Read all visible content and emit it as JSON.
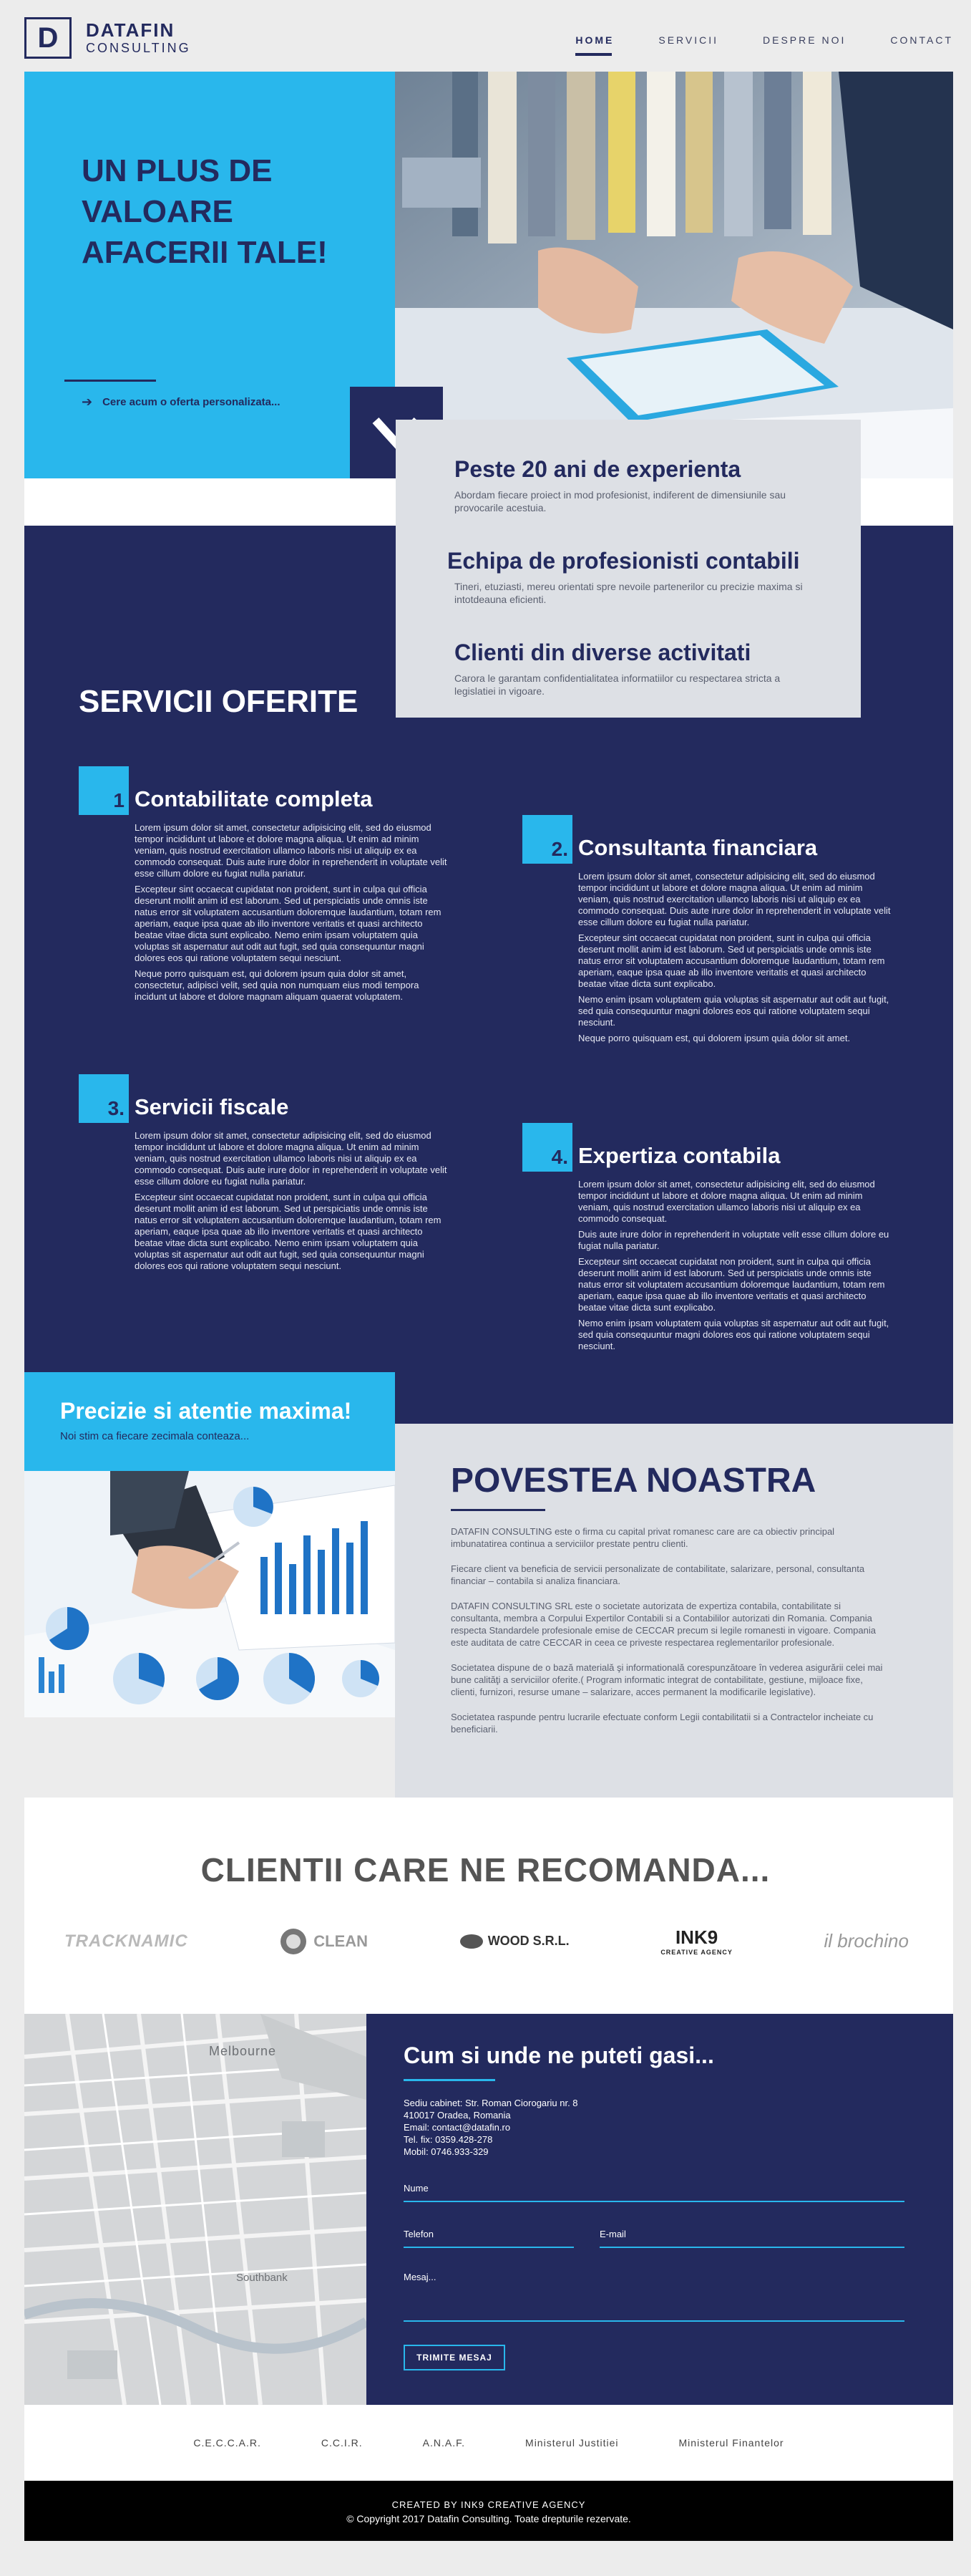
{
  "brand": {
    "letter": "D",
    "name": "DATAFIN",
    "sub": "CONSULTING"
  },
  "nav": [
    {
      "label": "HOME",
      "active": true
    },
    {
      "label": "SERVICII"
    },
    {
      "label": "DESPRE NOI"
    },
    {
      "label": "CONTACT"
    }
  ],
  "hero": {
    "title": "UN PLUS DE VALOARE AFACERII TALE!",
    "cta": "Cere acum o oferta personalizata..."
  },
  "features": [
    {
      "title": "Peste 20 ani de experienta",
      "text": "Abordam fiecare proiect in mod profesionist, indiferent de dimensiunile sau provocarile acestuia."
    },
    {
      "title": "Echipa de profesionisti contabili",
      "text": "Tineri, etuziasti, mereu orientati spre nevoile partenerilor cu precizie maxima si intotdeauna eficienti."
    },
    {
      "title": "Clienti din diverse activitati",
      "text": "Carora le garantam confidentialitatea informatiilor cu respectarea stricta a legislatiei in vigoare."
    }
  ],
  "services": {
    "title": "SERVICII OFERITE",
    "items": [
      {
        "num": "1",
        "title": "Contabilitate completa",
        "paragraphs": [
          "Lorem ipsum dolor sit amet, consectetur adipisicing elit, sed do eiusmod tempor incididunt ut labore et dolore magna aliqua. Ut enim ad minim veniam, quis nostrud exercitation ullamco laboris nisi ut aliquip ex ea commodo consequat. Duis aute irure dolor in reprehenderit in voluptate velit esse cillum dolore eu fugiat nulla pariatur.",
          "Excepteur sint occaecat cupidatat non proident, sunt in culpa qui officia deserunt mollit anim id est laborum. Sed ut perspiciatis unde omnis iste natus error sit voluptatem accusantium doloremque laudantium, totam rem aperiam, eaque ipsa quae ab illo inventore veritatis et quasi architecto beatae vitae dicta sunt explicabo. Nemo enim ipsam voluptatem quia voluptas sit aspernatur aut odit aut fugit, sed quia consequuntur magni dolores eos qui ratione voluptatem sequi nesciunt.",
          "Neque porro quisquam est, qui dolorem ipsum quia dolor sit amet, consectetur, adipisci velit, sed quia non numquam eius modi tempora incidunt ut labore et dolore magnam aliquam quaerat voluptatem."
        ]
      },
      {
        "num": "2.",
        "title": "Consultanta financiara",
        "paragraphs": [
          "Lorem ipsum dolor sit amet, consectetur adipisicing elit, sed do eiusmod tempor incididunt ut labore et dolore magna aliqua. Ut enim ad minim veniam, quis nostrud exercitation ullamco laboris nisi ut aliquip ex ea commodo consequat. Duis aute irure dolor in reprehenderit in voluptate velit esse cillum dolore eu fugiat nulla pariatur.",
          "Excepteur sint occaecat cupidatat non proident, sunt in culpa qui officia deserunt mollit anim id est laborum. Sed ut perspiciatis unde omnis iste natus error sit voluptatem accusantium doloremque laudantium, totam rem aperiam, eaque ipsa quae ab illo inventore veritatis et quasi architecto beatae vitae dicta sunt explicabo.",
          "Nemo enim ipsam voluptatem quia voluptas sit aspernatur aut odit aut fugit, sed quia consequuntur magni dolores eos qui ratione voluptatem sequi nesciunt.",
          "Neque porro quisquam est, qui dolorem ipsum quia dolor sit amet."
        ]
      },
      {
        "num": "3.",
        "title": "Servicii fiscale",
        "paragraphs": [
          "Lorem ipsum dolor sit amet, consectetur adipisicing elit, sed do eiusmod tempor incididunt ut labore et dolore magna aliqua. Ut enim ad minim veniam, quis nostrud exercitation ullamco laboris nisi ut aliquip ex ea commodo consequat. Duis aute irure dolor in reprehenderit in voluptate velit esse cillum dolore eu fugiat nulla pariatur.",
          "Excepteur sint occaecat cupidatat non proident, sunt in culpa qui officia deserunt mollit anim id est laborum. Sed ut perspiciatis unde omnis iste natus error sit voluptatem accusantium doloremque laudantium, totam rem aperiam, eaque ipsa quae ab illo inventore veritatis et quasi architecto beatae vitae dicta sunt explicabo. Nemo enim ipsam voluptatem quia voluptas sit aspernatur aut odit aut fugit, sed quia consequuntur magni dolores eos qui ratione voluptatem sequi nesciunt."
        ]
      },
      {
        "num": "4.",
        "title": "Expertiza contabila",
        "paragraphs": [
          "Lorem ipsum dolor sit amet, consectetur adipisicing elit, sed do eiusmod tempor incididunt ut labore et dolore magna aliqua. Ut enim ad minim veniam, quis nostrud exercitation ullamco laboris nisi ut aliquip ex ea commodo consequat.",
          "Duis aute irure dolor in reprehenderit in voluptate velit esse cillum dolore eu fugiat nulla pariatur.",
          "Excepteur sint occaecat cupidatat non proident, sunt in culpa qui officia deserunt mollit anim id est laborum. Sed ut perspiciatis unde omnis iste natus error sit voluptatem accusantium doloremque laudantium, totam rem aperiam, eaque ipsa quae ab illo inventore veritatis et quasi architecto beatae vitae dicta sunt explicabo.",
          "Nemo enim ipsam voluptatem quia voluptas sit aspernatur aut odit aut fugit, sed quia consequuntur magni dolores eos qui ratione voluptatem sequi nesciunt."
        ]
      }
    ]
  },
  "precision": {
    "title": "Precizie si atentie maxima!",
    "sub": "Noi stim ca fiecare zecimala conteaza..."
  },
  "story": {
    "title": "POVESTEA NOASTRA",
    "paragraphs": [
      "DATAFIN CONSULTING este o firma cu capital privat romanesc care are ca obiectiv principal imbunatatirea continua a serviciilor prestate pentru clienti.",
      "Fiecare client va beneficia de servicii personalizate de contabilitate, salarizare, personal, consultanta financiar – contabila si analiza financiara.",
      "DATAFIN CONSULTING SRL este o societate autorizata de expertiza contabila, contabilitate si consultanta, membra a Corpului Expertilor Contabili si a Contabililor autorizati din Romania. Compania respecta Standardele profesionale emise de CECCAR precum si legile romanesti in vigoare. Compania este auditata de catre CECCAR in ceea ce priveste respectarea reglementarilor profesionale.",
      "Societatea dispune de o bază materială şi informatională corespunzătoare în vederea asigurării celei mai bune calităţi a serviciilor oferite.( Program informatic integrat de contabilitate, gestiune, mijloace fixe, clienti, furnizori, resurse umane – salarizare, acces permanent la modificarile legislative).",
      "Societatea raspunde pentru lucrarile efectuate conform Legii contabilitatii si a Contractelor incheiate cu beneficiarii."
    ]
  },
  "clients": {
    "title": "CLIENTII CARE NE RECOMANDA...",
    "logos": [
      "TRACKNAMIC",
      "CLEAN",
      "WOOD S.R.L.",
      "INK9",
      "il brochino"
    ],
    "ink9_sub": "CREATIVE AGENCY"
  },
  "map": {
    "label": "Melbourne",
    "area": "Southbank"
  },
  "contact": {
    "title": "Cum si unde ne puteti gasi...",
    "lines": [
      "Sediu cabinet: Str. Roman Ciorogariu nr. 8",
      "410017 Oradea, Romania",
      "Email: contact@datafin.ro",
      "Tel. fix: 0359.428-278",
      "Mobil: 0746.933-329"
    ],
    "name_label": "Nume",
    "phone_label": "Telefon",
    "email_label": "E-mail",
    "message_label": "Mesaj...",
    "send_label": "TRIMITE MESAJ"
  },
  "partners": [
    "C.E.C.C.A.R.",
    "C.C.I.R.",
    "A.N.A.F.",
    "Ministerul Justitiei",
    "Ministerul Finantelor"
  ],
  "footer": {
    "credit": "CREATED BY INK9 CREATIVE AGENCY",
    "copyright": "© Copyright 2017 Datafin Consulting. Toate drepturile rezervate."
  },
  "colors": {
    "navy": "#232a5e",
    "accent": "#29b7ec",
    "light_gray": "#dde0e5"
  }
}
